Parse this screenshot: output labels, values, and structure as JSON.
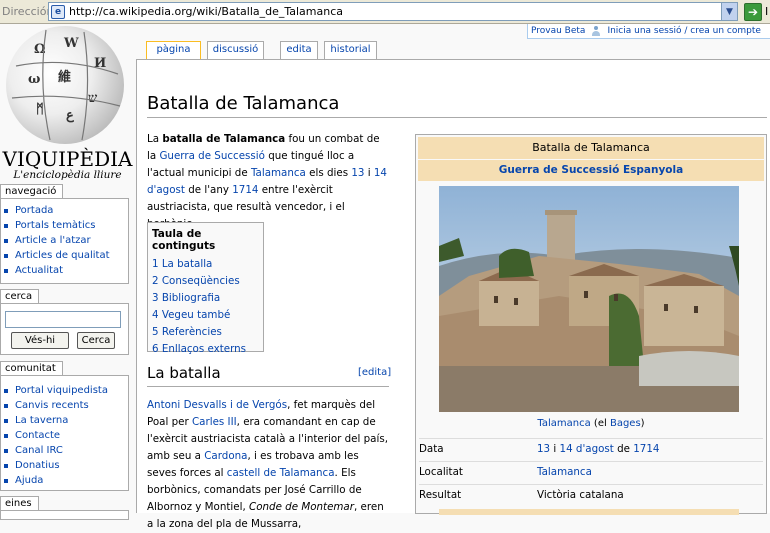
{
  "browser": {
    "address_label": "Dirección",
    "url": "http://ca.wikipedia.org/wiki/Batalla_de_Talamanca",
    "go_label": "I"
  },
  "personal": {
    "beta": "Provau Beta",
    "login": "Inicia una sessió / crea un compte"
  },
  "logo": {
    "wordmark": "VIQUIPÈDIA",
    "tagline": "L'enciclopèdia lliure"
  },
  "sidebar": {
    "navigation": {
      "heading": "navegació",
      "items": [
        "Portada",
        "Portals temàtics",
        "Article a l'atzar",
        "Articles de qualitat",
        "Actualitat"
      ]
    },
    "search": {
      "heading": "cerca",
      "go_button": "Vés-hi",
      "search_button": "Cerca"
    },
    "community": {
      "heading": "comunitat",
      "items": [
        "Portal viquipedista",
        "Canvis recents",
        "La taverna",
        "Contacte",
        "Canal IRC",
        "Donatius",
        "Ajuda"
      ]
    },
    "tools": {
      "heading": "eines"
    }
  },
  "tabs": [
    "pàgina",
    "discussió",
    "edita",
    "historial"
  ],
  "article": {
    "title": "Batalla de Talamanca",
    "intro": {
      "p1": "La ",
      "bold": "batalla de Talamanca",
      "p2": " fou un combat de la ",
      "link1": "Guerra de Successió",
      "p3": " que tingué lloc a l'actual municipi de ",
      "link2": "Talamanca",
      "p4": " els dies ",
      "link3": "13",
      "p5": " i ",
      "link4": "14 d'agost",
      "p6": " de l'any ",
      "link5": "1714",
      "p7": " entre l'exèrcit austriacista, que resultà vencedor, i el borbònic."
    },
    "toc": {
      "title": "Taula de continguts",
      "items": [
        "1 La batalla",
        "2 Conseqüències",
        "3 Bibliografia",
        "4 Vegeu també",
        "5 Referències",
        "6 Enllaços externs"
      ]
    },
    "section": {
      "heading": "La batalla",
      "edit": "[edita]",
      "link1": "Antoni Desvalls i de Vergós",
      "t1": ", fet marquès del Poal per ",
      "link2": "Carles III",
      "t2": ", era comandant en cap de l'exèrcit austriacista català a l'interior del país, amb seu a ",
      "link3": "Cardona",
      "t3": ", i es trobava amb les seves forces al ",
      "link4": "castell de Talamanca",
      "t4": ". Els borbònics, comandats per José Carrillo de Albornoz y Montiel, ",
      "italic": "Conde de Montemar",
      "t5": ", eren a la zona del pla de Mussarra,"
    }
  },
  "infobox": {
    "title": "Batalla de Talamanca",
    "subtitle": "Guerra de Successió Espanyola",
    "caption_link": "Talamanca",
    "caption_rest": " (el ",
    "caption_link2": "Bages",
    "caption_end": ")",
    "rows": [
      {
        "key": "Data",
        "v1": "13",
        "v2": " i ",
        "v3": "14 d'agost",
        "v4": " de ",
        "v5": "1714"
      },
      {
        "key": "Localitat",
        "value": "Talamanca"
      },
      {
        "key": "Resultat",
        "value": "Victòria catalana"
      }
    ]
  },
  "colors": {
    "link": "#0645ad",
    "infobox_header": "#f5deb3",
    "selected_tab_border": "#fabd23"
  }
}
